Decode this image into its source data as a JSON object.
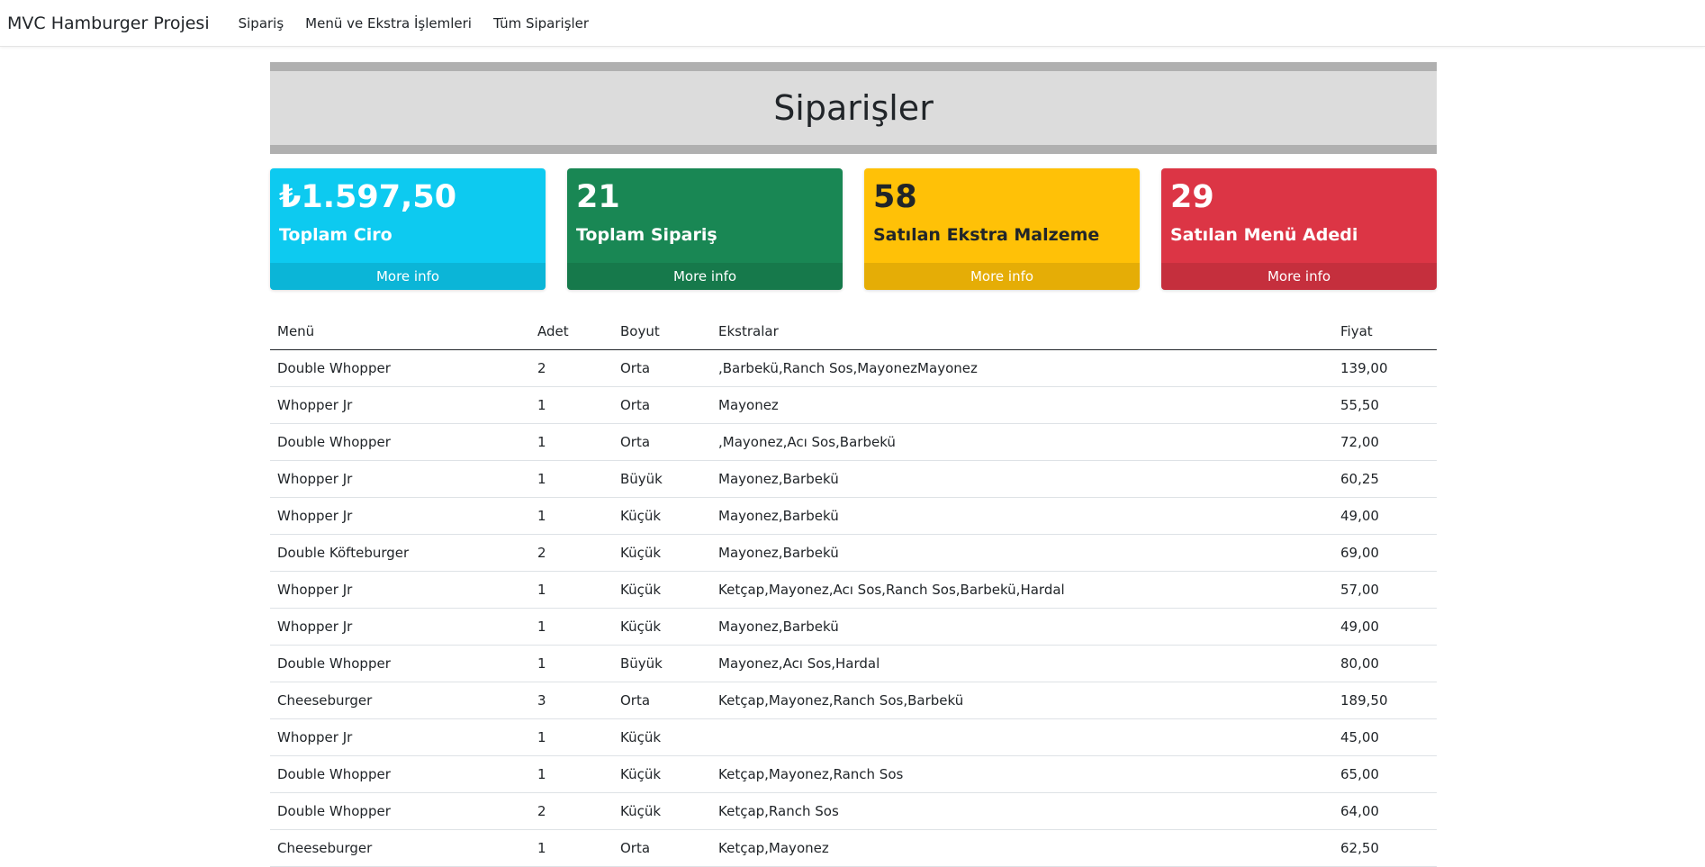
{
  "navbar": {
    "brand": "MVC Hamburger Projesi",
    "links": [
      "Sipariş",
      "Menü ve Ekstra İşlemleri",
      "Tüm Siparişler"
    ]
  },
  "page": {
    "title": "Siparişler"
  },
  "cards": [
    {
      "value": "₺1.597,50",
      "label": "Toplam Ciro",
      "more": "More info",
      "color": "#0dcaf0"
    },
    {
      "value": "21",
      "label": "Toplam Sipariş",
      "more": "More info",
      "color": "#198754"
    },
    {
      "value": "58",
      "label": "Satılan Ekstra Malzeme",
      "more": "More info",
      "color": "#ffc107"
    },
    {
      "value": "29",
      "label": "Satılan Menü Adedi",
      "more": "More info",
      "color": "#dc3545"
    }
  ],
  "table": {
    "headers": [
      "Menü",
      "Adet",
      "Boyut",
      "Ekstralar",
      "Fiyat"
    ],
    "rows": [
      [
        "Double Whopper",
        "2",
        "Orta",
        ",Barbekü,Ranch Sos,MayonezMayonez",
        "139,00"
      ],
      [
        "Whopper Jr",
        "1",
        "Orta",
        "Mayonez",
        "55,50"
      ],
      [
        "Double Whopper",
        "1",
        "Orta",
        ",Mayonez,Acı Sos,Barbekü",
        "72,00"
      ],
      [
        "Whopper Jr",
        "1",
        "Büyük",
        "Mayonez,Barbekü",
        "60,25"
      ],
      [
        "Whopper Jr",
        "1",
        "Küçük",
        "Mayonez,Barbekü",
        "49,00"
      ],
      [
        "Double Köfteburger",
        "2",
        "Küçük",
        "Mayonez,Barbekü",
        "69,00"
      ],
      [
        "Whopper Jr",
        "1",
        "Küçük",
        "Ketçap,Mayonez,Acı Sos,Ranch Sos,Barbekü,Hardal",
        "57,00"
      ],
      [
        "Whopper Jr",
        "1",
        "Küçük",
        "Mayonez,Barbekü",
        "49,00"
      ],
      [
        "Double Whopper",
        "1",
        "Büyük",
        "Mayonez,Acı Sos,Hardal",
        "80,00"
      ],
      [
        "Cheeseburger",
        "3",
        "Orta",
        "Ketçap,Mayonez,Ranch Sos,Barbekü",
        "189,50"
      ],
      [
        "Whopper Jr",
        "1",
        "Küçük",
        "",
        "45,00"
      ],
      [
        "Double Whopper",
        "1",
        "Küçük",
        "Ketçap,Mayonez,Ranch Sos",
        "65,00"
      ],
      [
        "Double Whopper",
        "2",
        "Küçük",
        "Ketçap,Ranch Sos",
        "64,00"
      ],
      [
        "Cheeseburger",
        "1",
        "Orta",
        "Ketçap,Mayonez",
        "62,50"
      ]
    ]
  }
}
